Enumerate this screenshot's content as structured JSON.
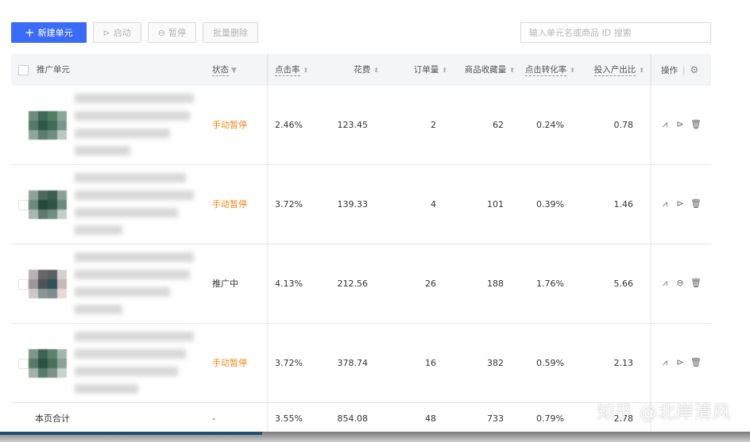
{
  "toolbar": {
    "new_unit": "新建单元",
    "start": "启动",
    "pause": "暂停",
    "batch_delete": "批量删除"
  },
  "search": {
    "placeholder": "输入单元名或商品 ID 搜索"
  },
  "columns": {
    "unit": "推广单元",
    "status": "状态",
    "ctr": "点击率",
    "cost": "花费",
    "orders": "订单量",
    "favorites": "商品收藏量",
    "cvr": "点击转化率",
    "roi": "投入产出比",
    "ops": "操作"
  },
  "rows": [
    {
      "status": "手动暂停",
      "ctr": "2.46%",
      "cost": "123.45",
      "orders": "2",
      "favorites": "62",
      "cvr": "0.24%",
      "roi": "0.78"
    },
    {
      "status": "手动暂停",
      "ctr": "3.72%",
      "cost": "139.33",
      "orders": "4",
      "favorites": "101",
      "cvr": "0.39%",
      "roi": "1.46"
    },
    {
      "status": "推广中",
      "ctr": "4.13%",
      "cost": "212.56",
      "orders": "26",
      "favorites": "188",
      "cvr": "1.76%",
      "roi": "5.66"
    },
    {
      "status": "手动暂停",
      "ctr": "3.72%",
      "cost": "378.74",
      "orders": "16",
      "favorites": "382",
      "cvr": "0.59%",
      "roi": "2.13"
    }
  ],
  "footer": {
    "label": "本页合计",
    "status": "-",
    "ctr": "3.55%",
    "cost": "854.08",
    "orders": "48",
    "favorites": "733",
    "cvr": "0.79%",
    "roi": "2.78"
  },
  "watermark": "知乎 @北岸清风",
  "icons": {
    "chart": "trend-chart-icon",
    "play": "play-circle-icon",
    "pause": "pause-circle-icon",
    "delete": "trash-icon",
    "settings": "gear-icon"
  },
  "colors": {
    "primary": "#3b6cf7",
    "paused": "#f0861a"
  }
}
